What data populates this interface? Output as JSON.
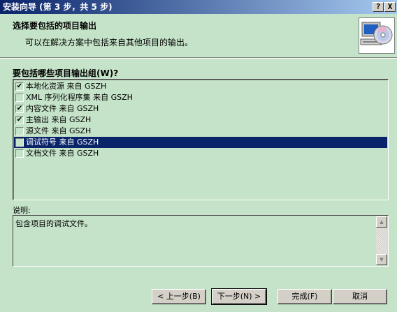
{
  "window": {
    "title": "安装向导 (第 3 步，共 5 步)",
    "help_label": "?",
    "close_label": "X"
  },
  "header": {
    "title": "选择要包括的项目输出",
    "description": "可以在解决方案中包括来自其他项目的输出。",
    "icon": "computer-cd-icon"
  },
  "outputs": {
    "label": "要包括哪些项目输出组(W)?",
    "items": [
      {
        "label": "本地化资源 来自 GSZH",
        "checked": true,
        "selected": false
      },
      {
        "label": "XML 序列化程序集 来自 GSZH",
        "checked": false,
        "selected": false
      },
      {
        "label": "内容文件 来自 GSZH",
        "checked": true,
        "selected": false
      },
      {
        "label": "主输出 来自 GSZH",
        "checked": true,
        "selected": false
      },
      {
        "label": "源文件 来自 GSZH",
        "checked": false,
        "selected": false
      },
      {
        "label": "调试符号 来自 GSZH",
        "checked": false,
        "selected": true
      },
      {
        "label": "文档文件 来自 GSZH",
        "checked": false,
        "selected": false
      }
    ]
  },
  "description": {
    "label": "说明:",
    "text": "包含项目的调试文件。"
  },
  "buttons": {
    "back": "< 上一步(B)",
    "next": "下一步(N) >",
    "finish": "完成(F)",
    "cancel": "取消"
  },
  "colors": {
    "background": "#c5e3c8",
    "selection": "#0a246a",
    "titlebar": "#0a246a"
  }
}
